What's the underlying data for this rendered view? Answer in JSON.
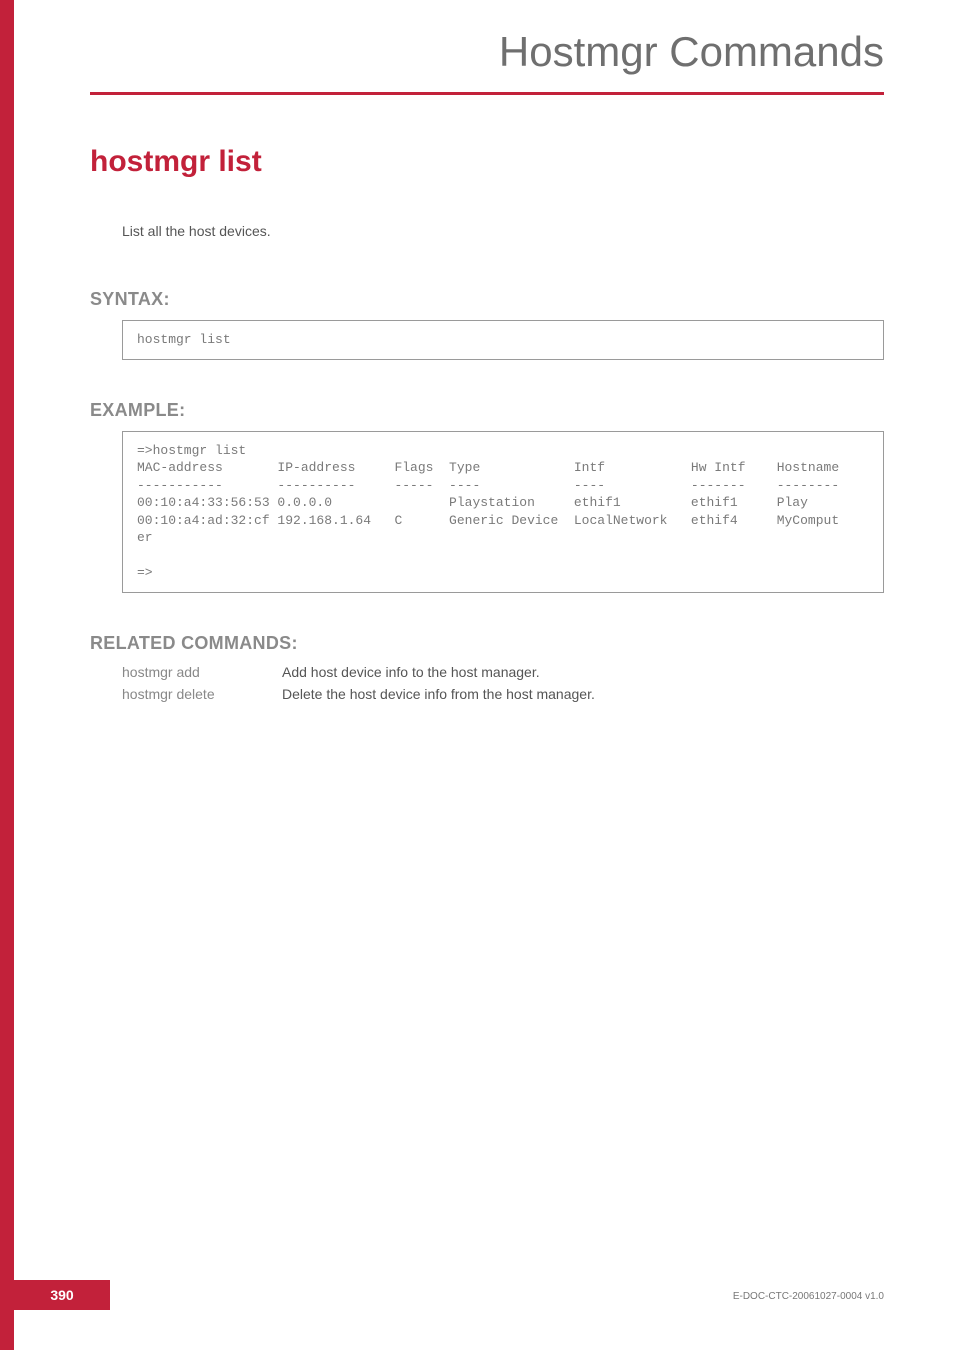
{
  "header": {
    "title": "Hostmgr Commands"
  },
  "page": {
    "title": "hostmgr list",
    "intro": "List all the host devices.",
    "syntax_label": "SYNTAX:",
    "syntax_code": "hostmgr list",
    "example_label": "EXAMPLE:",
    "example_code": "=>hostmgr list\nMAC-address       IP-address     Flags  Type            Intf           Hw Intf    Hostname\n-----------       ----------     -----  ----            ----           -------    --------\n00:10:a4:33:56:53 0.0.0.0               Playstation     ethif1         ethif1     Play\n00:10:a4:ad:32:cf 192.168.1.64   C      Generic Device  LocalNetwork   ethif4     MyComput\ner\n\n=>",
    "related_label": "RELATED COMMANDS:",
    "related": [
      {
        "cmd": "hostmgr add",
        "desc": "Add host device info to the host manager."
      },
      {
        "cmd": "hostmgr delete",
        "desc": "Delete the host device info from the host manager."
      }
    ]
  },
  "footer": {
    "page_number": "390",
    "doc_id": "E-DOC-CTC-20061027-0004 v1.0"
  }
}
